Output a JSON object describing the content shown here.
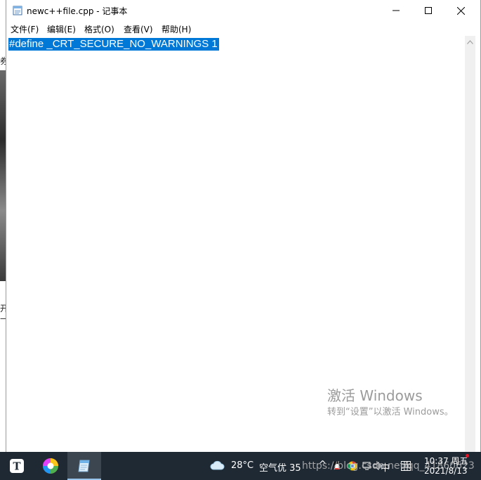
{
  "window": {
    "title": "newc++file.cpp - 记事本",
    "controls": {
      "minimize": "minimize",
      "maximize": "maximize",
      "close": "close"
    }
  },
  "menu": [
    {
      "label": "文件(F)"
    },
    {
      "label": "编辑(E)"
    },
    {
      "label": "格式(O)"
    },
    {
      "label": "查看(V)"
    },
    {
      "label": "帮助(H)"
    }
  ],
  "editor": {
    "lines": [
      "#define _CRT_SECURE_NO_WARNINGS 1"
    ],
    "selection_color": "#0078d7"
  },
  "watermark": {
    "title": "激活 Windows",
    "subtitle": "转到“设置”以激活 Windows。"
  },
  "background_fragments": [
    "券",
    "开",
    "—"
  ],
  "taskbar": {
    "apps": [
      {
        "icon": "typora-t-icon"
      },
      {
        "icon": "color-wheel-app-icon"
      },
      {
        "icon": "notepad-icon",
        "active": true
      }
    ],
    "weather": {
      "temperature": "28°C",
      "air": "空气优 35"
    },
    "overlay_url": "https://blog.csdn.net/qq_41860623",
    "tray": {
      "chevron": "^",
      "ime": "中"
    },
    "clock": {
      "time": "10:37 周五",
      "date": "2021/8/13"
    },
    "colors": {
      "background": "#1f2933",
      "active": "#3c4650",
      "accent": "#99c5ec",
      "notification": "#e81123"
    }
  }
}
